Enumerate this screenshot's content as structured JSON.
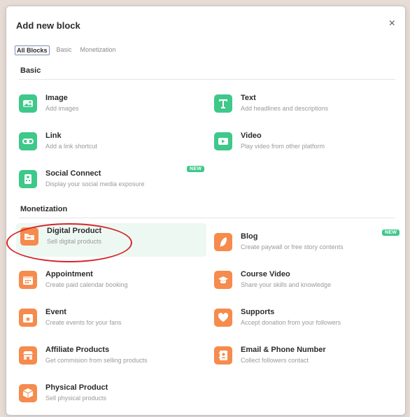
{
  "modal": {
    "title": "Add new block",
    "close_symbol": "×"
  },
  "tabs": [
    {
      "label": "All Blocks",
      "active": true
    },
    {
      "label": "Basic",
      "active": false
    },
    {
      "label": "Monetization",
      "active": false
    }
  ],
  "sections": {
    "basic": {
      "title": "Basic",
      "items": [
        {
          "name": "Image",
          "desc": "Add images",
          "icon": "image-icon"
        },
        {
          "name": "Text",
          "desc": "Add headlines and descriptions",
          "icon": "text-icon"
        },
        {
          "name": "Link",
          "desc": "Add a link shortcut",
          "icon": "link-icon"
        },
        {
          "name": "Video",
          "desc": "Play video from other platform",
          "icon": "video-icon"
        },
        {
          "name": "Social Connect",
          "desc": "Display your social media exposure",
          "icon": "social-icon",
          "badge": "NEW"
        }
      ]
    },
    "monetization": {
      "title": "Monetization",
      "items": [
        {
          "name": "Digital Product",
          "desc": "Sell digital products",
          "icon": "folder-icon"
        },
        {
          "name": "Blog",
          "desc": "Create paywall or free story contents",
          "icon": "quill-icon",
          "badge": "NEW"
        },
        {
          "name": "Appointment",
          "desc": "Create paid calendar booking",
          "icon": "calendar-icon"
        },
        {
          "name": "Course Video",
          "desc": "Share your skills and knowledge",
          "icon": "graduation-cap-icon"
        },
        {
          "name": "Event",
          "desc": "Create events for your fans",
          "icon": "event-calendar-icon"
        },
        {
          "name": "Supports",
          "desc": "Accept donation from your followers",
          "icon": "heart-icon"
        },
        {
          "name": "Affiliate Products",
          "desc": "Get commision from selling products",
          "icon": "store-icon"
        },
        {
          "name": "Email & Phone Number",
          "desc": "Collect followers contact",
          "icon": "contact-book-icon"
        },
        {
          "name": "Physical Product",
          "desc": "Sell physical products",
          "icon": "box-icon"
        }
      ]
    }
  },
  "colors": {
    "green": "#3ec88a",
    "orange": "#f58b4c",
    "highlight": "#eef8f3",
    "annotation_red": "#d6262c"
  }
}
